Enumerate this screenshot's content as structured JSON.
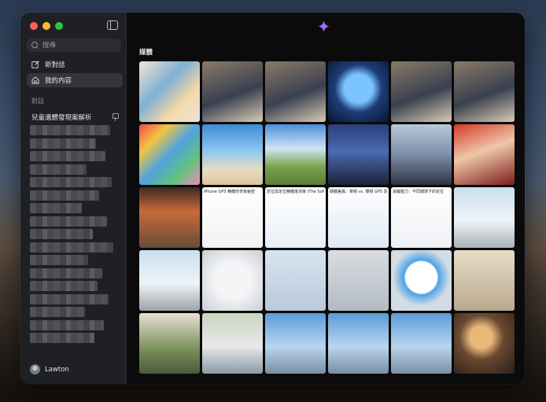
{
  "sidebar": {
    "search_placeholder": "搜尋",
    "nav": [
      {
        "label": "新對話",
        "icon": "new-chat-icon"
      },
      {
        "label": "我的內容",
        "icon": "home-icon"
      }
    ],
    "section_label": "對話",
    "pinned_conversation": "兒童遺體發現案解析",
    "user_name": "Lawton"
  },
  "main": {
    "media_title": "媒體"
  },
  "media_tiles": [
    {
      "name": "glowing-figures",
      "bg": "linear-gradient(135deg,#f3e4d0 0%,#7fb0d6 40%,#f6d9a8 70%,#e8e4df 100%)"
    },
    {
      "name": "man-car-tablet-1",
      "bg": "linear-gradient(160deg,#8a7a66 0%,#3a4050 55%,#d8cbb4 100%)"
    },
    {
      "name": "man-car-tablet-2",
      "bg": "linear-gradient(160deg,#8a7a66 0%,#3a4050 55%,#d8cbb4 100%)"
    },
    {
      "name": "blue-dome-city",
      "bg": "radial-gradient(circle at 50% 45%,#7bc4ff 0 18px,#1d3d78 30px,#0a1430 100%)"
    },
    {
      "name": "man-car-tablet-3",
      "bg": "linear-gradient(160deg,#8a7a66 0%,#3a4050 55%,#d8cbb4 100%)"
    },
    {
      "name": "man-car-tablet-4",
      "bg": "linear-gradient(160deg,#8a7a66 0%,#3a4050 55%,#d8cbb4 100%)"
    },
    {
      "name": "colorful-collage",
      "bg": "linear-gradient(135deg,#e84d4d 0%,#f4c542 25%,#4fa3e0 50%,#63c27b 75%,#f08ac0 100%)"
    },
    {
      "name": "beach-coast",
      "bg": "linear-gradient(180deg,#3d8bd6 0%,#8fc9ee 45%,#e9dcc0 75%,#d8c59e 100%)"
    },
    {
      "name": "green-field-sky",
      "bg": "linear-gradient(180deg,#4a8fd9 0%,#cfe4f5 40%,#7aa44e 70%,#5c7d36 100%)"
    },
    {
      "name": "gemini-stage-crowd",
      "bg": "linear-gradient(180deg,#2a3f7a 0%,#4a6ab0 45%,#1c2236 100%)"
    },
    {
      "name": "city-skyline-google",
      "bg": "linear-gradient(180deg,#b8c8de 0%,#7d8ea8 50%,#2b3444 100%)"
    },
    {
      "name": "lunar-new-year",
      "bg": "linear-gradient(160deg,#d23b2b 0%,#f0c6a8 45%,#7a1e1a 100%)"
    },
    {
      "name": "night-market-street",
      "bg": "linear-gradient(180deg,#3b2a22 0%,#c86a3a 40%,#6a4a3a 100%)"
    },
    {
      "name": "gps-article-1",
      "bg": "linear-gradient(180deg,#ffffff 0%,#f2f2f2 100%)",
      "caption": "iPhone GPS 精確的背後秘密"
    },
    {
      "name": "gps-article-2",
      "bg": "linear-gradient(180deg,#ffffff 0%,#e9eef6 100%)",
      "caption": "定位與定位精確度清單 (The Software)"
    },
    {
      "name": "gps-article-3",
      "bg": "linear-gradient(180deg,#ffffff 0%,#dfe9f5 100%)",
      "caption": "硬體差異：單頻 vs. 雙頻 GPS 定位"
    },
    {
      "name": "gps-article-4",
      "bg": "linear-gradient(180deg,#ffffff 0%,#eef1f4 100%)",
      "caption": "追蹤能力：不同環境下的定位"
    },
    {
      "name": "bus-stop-mountains",
      "bg": "linear-gradient(180deg,#c9dff0 0%,#eef3f7 55%,#a8b2b8 100%)"
    },
    {
      "name": "bus-stop-road",
      "bg": "linear-gradient(180deg,#c9dff0 0%,#eef3f7 55%,#9aa4aa 100%)"
    },
    {
      "name": "game-controller",
      "bg": "radial-gradient(circle at 50% 50%,#f4f5f7 0 22px,#dde0e4 40px,#c9ccd1 100%)"
    },
    {
      "name": "man-safari-icons-1",
      "bg": "linear-gradient(180deg,#d7e3ef 0%,#b9c9db 100%)"
    },
    {
      "name": "man-apple-logo",
      "bg": "linear-gradient(180deg,#d9dde2 0%,#b3bac3 100%)"
    },
    {
      "name": "man-safari-icon-2",
      "bg": "radial-gradient(circle at 50% 45%,#ffffff 0 20px,#4aa3e8 22px,#d3dbe4 36px)"
    },
    {
      "name": "people-on-phones",
      "bg": "linear-gradient(180deg,#e8dcc8 0%,#b9a98e 100%)"
    },
    {
      "name": "living-room-plant",
      "bg": "linear-gradient(180deg,#e8e0d2 0%,#7a8f5a 60%,#4a5a3a 100%)"
    },
    {
      "name": "man-suit-office",
      "bg": "linear-gradient(180deg,#c8d4c0 0%,#e8e8e8 55%,#8a9aa8 100%)"
    },
    {
      "name": "sea-pole-1",
      "bg": "linear-gradient(180deg,#5c9ad6 0%,#b8d6ef 55%,#7a8ea0 100%)"
    },
    {
      "name": "sea-pole-2",
      "bg": "linear-gradient(180deg,#5c9ad6 0%,#b8d6ef 55%,#7a8ea0 100%)"
    },
    {
      "name": "sea-horizon",
      "bg": "linear-gradient(180deg,#5c9ad6 0%,#b8d6ef 55%,#7a8ea0 100%)"
    },
    {
      "name": "cat-santa-hat",
      "bg": "radial-gradient(circle at 45% 40%,#e8b878 0 14px,#6a4a30 28px,#2a1e18 100%)"
    }
  ]
}
